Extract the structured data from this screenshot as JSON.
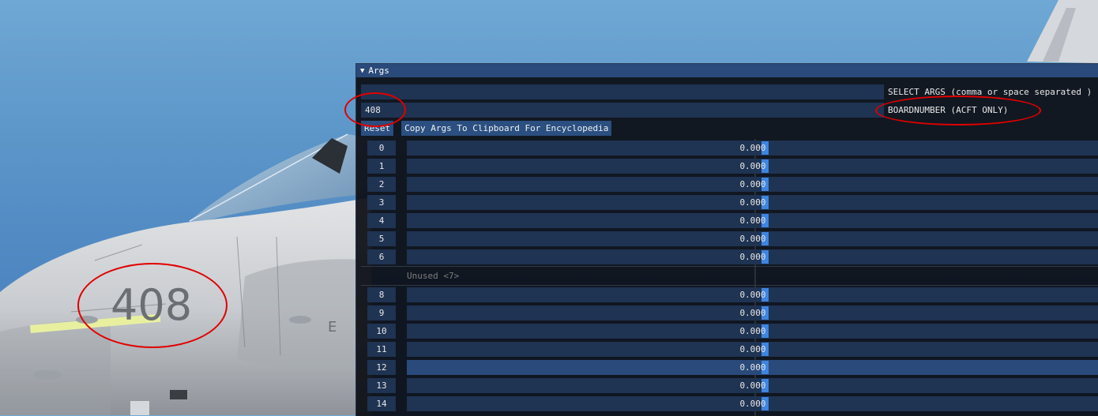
{
  "window": {
    "title": "Args",
    "collapse_icon": "triangle-down-icon"
  },
  "aircraft": {
    "board_number_painted": "408"
  },
  "fields": {
    "select_args": {
      "value": "",
      "label": "SELECT ARGS (comma or space separated )"
    },
    "board_number": {
      "value": "408",
      "label": "BOARDNUMBER (ACFT ONLY)"
    }
  },
  "buttons": {
    "reset": "Reset",
    "copy": "Copy Args To Clipboard For Encyclopedia"
  },
  "args_group_1": [
    {
      "id": "0",
      "value": "0.000"
    },
    {
      "id": "1",
      "value": "0.000"
    },
    {
      "id": "2",
      "value": "0.000"
    },
    {
      "id": "3",
      "value": "0.000"
    },
    {
      "id": "4",
      "value": "0.000"
    },
    {
      "id": "5",
      "value": "0.000"
    },
    {
      "id": "6",
      "value": "0.000"
    }
  ],
  "unused_label": "Unused <7>",
  "args_group_2": [
    {
      "id": "8",
      "value": "0.000"
    },
    {
      "id": "9",
      "value": "0.000"
    },
    {
      "id": "10",
      "value": "0.000"
    },
    {
      "id": "11",
      "value": "0.000"
    },
    {
      "id": "12",
      "value": "0.000"
    },
    {
      "id": "13",
      "value": "0.000"
    },
    {
      "id": "14",
      "value": "0.000"
    }
  ],
  "colors": {
    "annotation": "#e00000",
    "title_bar": "#294a7a",
    "frame": "#1f3352",
    "slider_grab": "#3d85e0"
  }
}
